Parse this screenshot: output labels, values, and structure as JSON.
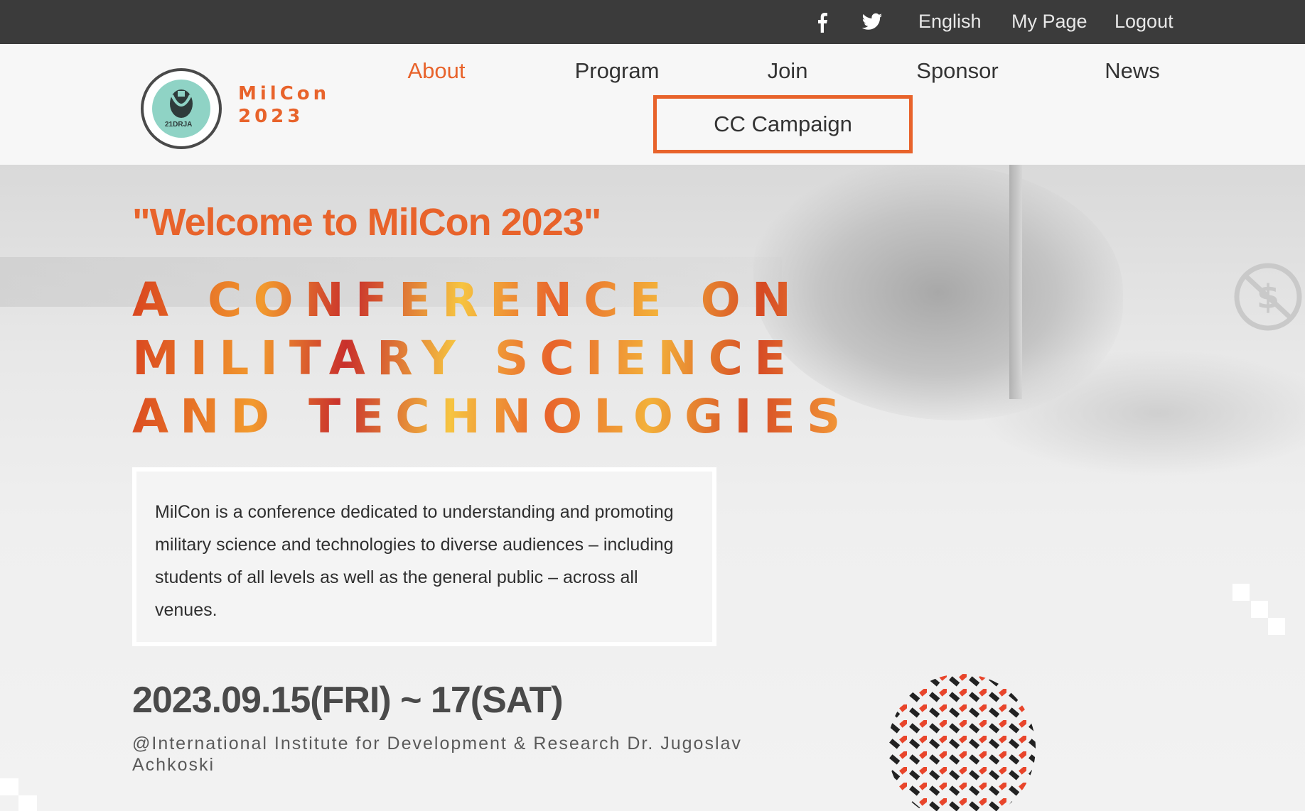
{
  "topbar": {
    "social": [
      {
        "icon": "facebook-icon"
      },
      {
        "icon": "twitter-icon"
      }
    ],
    "language": "English",
    "my_page": "My Page",
    "logout": "Logout"
  },
  "header": {
    "logo_line1": "MilCon",
    "logo_line2": "2023",
    "logo_badge": "21DRJA",
    "nav": {
      "about": "About",
      "program": "Program",
      "join": "Join",
      "sponsor": "Sponsor",
      "news": "News",
      "cc_campaign": "CC Campaign"
    }
  },
  "hero": {
    "welcome": "\"Welcome to MilCon 2023\"",
    "headline_1": "A CONFERENCE ON",
    "headline_2": "MILITARY SCIENCE",
    "headline_3": "AND TECHNOLOGIES",
    "description": "MilCon is a conference dedicated to understanding and promoting military science and technologies to diverse audiences – including students of all levels as well as the general public – across all venues.",
    "date": "2023.09.15(FRI) ~ 17(SAT)",
    "venue": "@International Institute for Development & Research Dr. Jugoslav Achkoski"
  },
  "colors": {
    "accent": "#e8632b",
    "topbar": "#3b3b3b",
    "logo_teal": "#8fd3c5"
  }
}
